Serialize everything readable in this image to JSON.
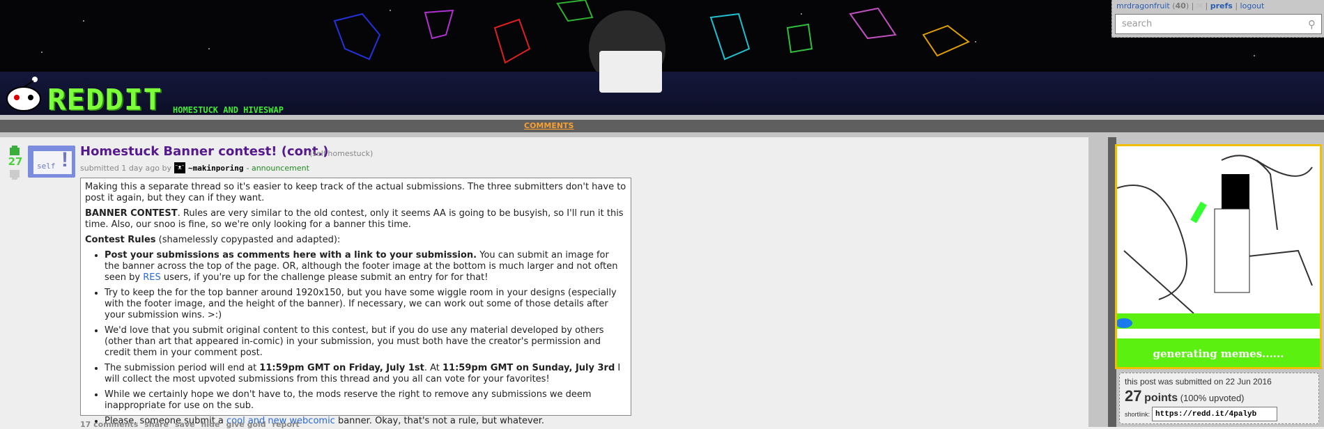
{
  "header": {
    "logo_text": "REDDIT",
    "subreddit_name": "HOMESTUCK AND HIVESWAP"
  },
  "user": {
    "name": "mrdragonfruit",
    "karma": "40",
    "prefs": "prefs",
    "logout": "logout",
    "mail_icon": "envelope-icon"
  },
  "search": {
    "placeholder": "search"
  },
  "tabs": {
    "comments": "COMMENTS"
  },
  "post": {
    "score": "27",
    "thumbnail_label": "self",
    "title": "Homestuck Banner contest! (cont.)",
    "domain": "(self.homestuck)",
    "submitted": "submitted 1 day ago by",
    "author": "~makinporing",
    "flair": "- announcement",
    "body": {
      "p1": "Making this a separate thread so it's easier to keep track of the actual submissions. The three submitters don't have to post it again, but they can if they want.",
      "p2_bold": "BANNER CONTEST",
      "p2": ". Rules are very similar to the old contest, only it seems AA is going to be busyish, so I'll run it this time. Also, our snoo is fine, so we're only looking for a banner this time.",
      "p3_bold": "Contest Rules",
      "p3": " (shamelessly copypasted and adapted):",
      "li1_bold": "Post your submissions as comments here with a link to your submission.",
      "li1_a": " You can submit an image for the banner across the top of the page. OR, although the footer image at the bottom is much larger and not often seen by ",
      "li1_link": "RES",
      "li1_b": " users, if you're up for the challenge please submit an entry for for that!",
      "li2": "Try to keep the for the top banner around 1920x150, but you have some wiggle room in your designs (especially with the footer image, and the height of the banner). If necessary, we can work out some of those details after your submission wins. >:)",
      "li3": "We'd love that you submit original content to this contest, but if you do use any material developed by others (other than art that appeared in-comic) in your submission, you must both have the creator's permission and credit them in your comment post.",
      "li4_a": "The submission period will end at ",
      "li4_b1": "11:59pm GMT on Friday, July 1st",
      "li4_c": ". At ",
      "li4_b2": "11:59pm GMT on Sunday, July 3rd",
      "li4_d": " I will collect the most upvoted submissions from this thread and you all can vote for your favorites!",
      "li5": "While we certainly hope we don't have to, the mods reserve the right to remove any submissions we deem inappropriate for use on the sub.",
      "li6_a": "Please, someone submit a ",
      "li6_link": "cool and new webcomic",
      "li6_b": " banner. Okay, that's not a rule, but whatever."
    },
    "buttons": [
      "17 comments",
      "share",
      "save",
      "hide",
      "give gold",
      "report"
    ]
  },
  "sidebar": {
    "image_caption": "generating memes......",
    "submitted_on": "this post was submitted on 22 Jun 2016",
    "points": "27",
    "points_label": "points",
    "upvoted": "(100% upvoted)",
    "shortlink_label": "shortlink:",
    "shortlink": "https://redd.it/4palyb"
  },
  "colors": {
    "title": "#551a8b",
    "score": "#4ad23e",
    "accent": "#f7a032",
    "link": "#2a6ad8"
  }
}
